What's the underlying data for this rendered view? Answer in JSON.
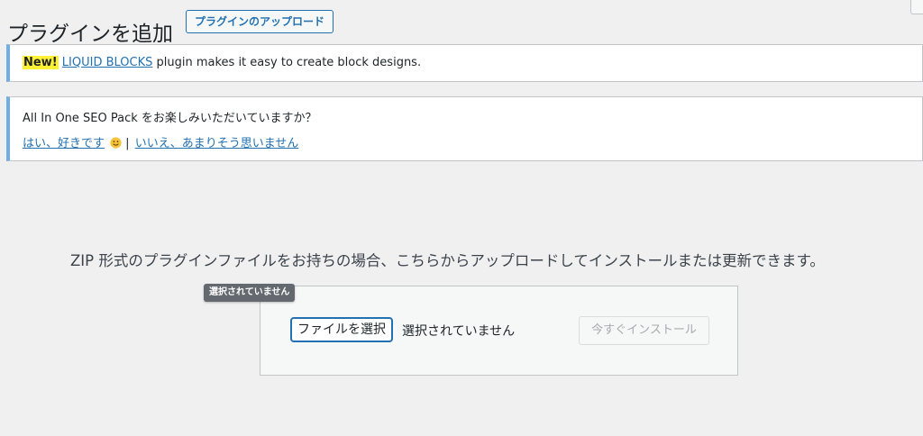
{
  "header": {
    "title": "プラグインを追加",
    "upload_button": "プラグインのアップロード"
  },
  "notices": {
    "liquid": {
      "badge": "New!",
      "link": "LIQUID BLOCKS",
      "text": " plugin makes it easy to create block designs."
    },
    "seo": {
      "question": "All In One SEO Pack をお楽しみいただいていますか？",
      "yes_link": "はい、好きです",
      "separator": "|",
      "no_link": "いいえ、あまりそう思いません"
    }
  },
  "upload": {
    "description": "ZIP 形式のプラグインファイルをお持ちの場合、こちらからアップロードしてインストールまたは更新できます。",
    "tooltip": "選択されていません",
    "file_button": "ファイルを選択",
    "file_status": "選択されていません",
    "install_button": "今すぐインストール"
  },
  "colors": {
    "accent": "#2271b1",
    "notice_border": "#72aee6",
    "badge_bg": "#fff133",
    "background": "#f0f0f1"
  },
  "icons": {
    "smile": "smile-emoji-icon"
  }
}
